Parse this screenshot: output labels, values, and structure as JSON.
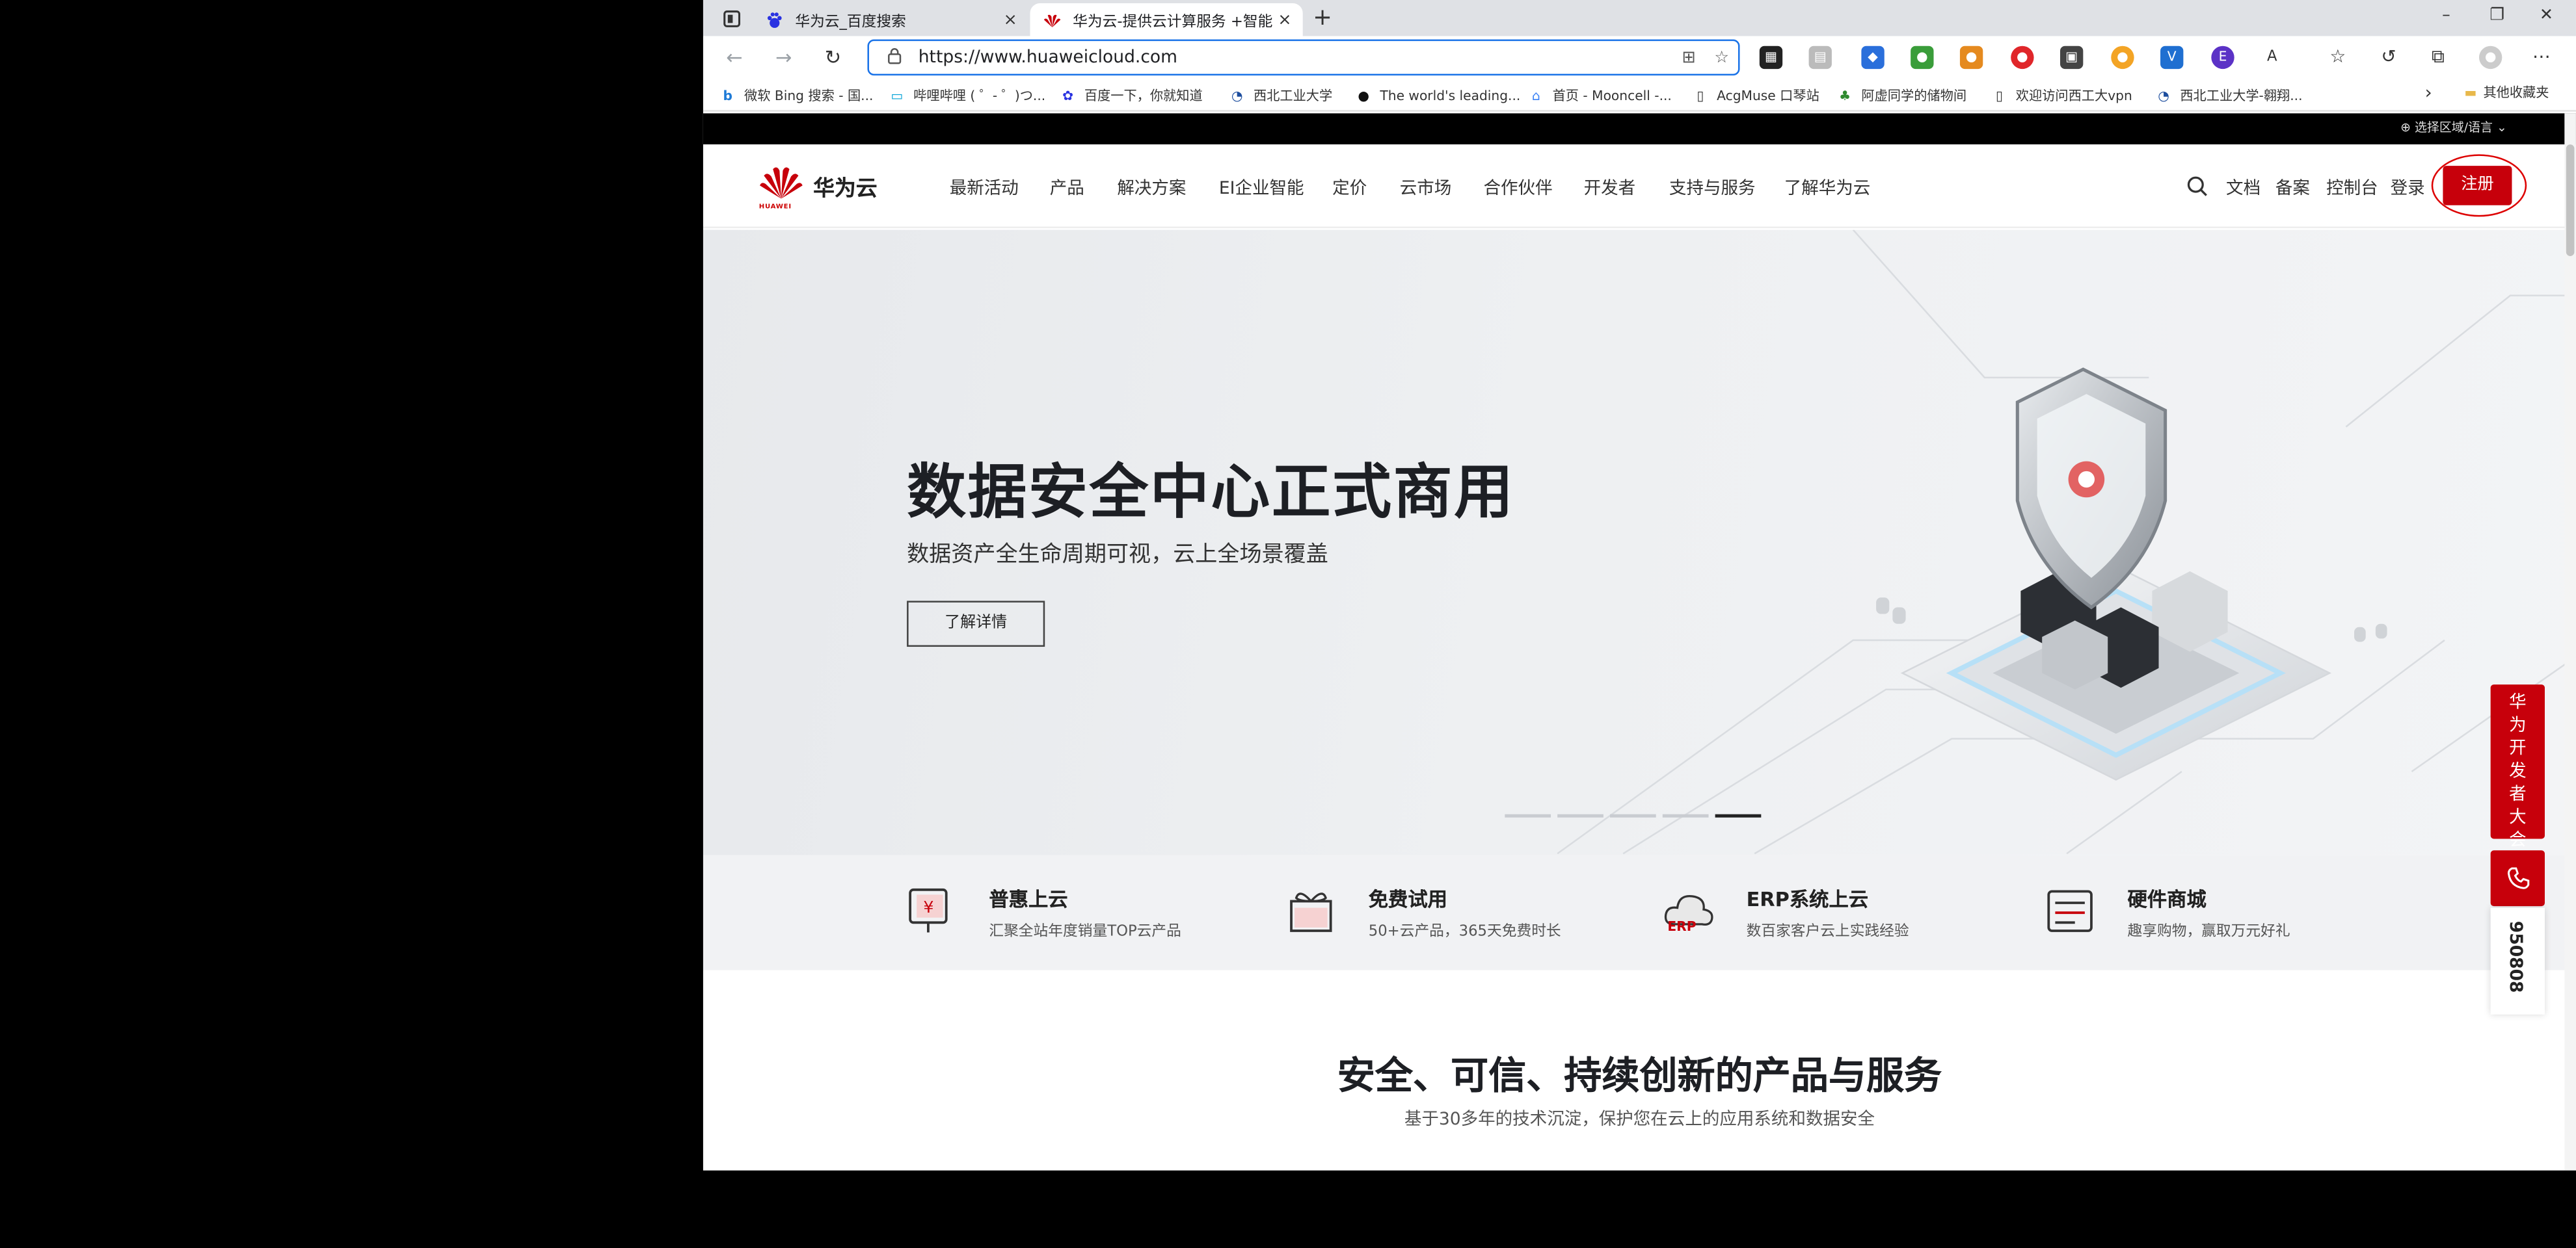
{
  "browser": {
    "tabs": [
      {
        "title": "华为云_百度搜索",
        "close": "×"
      },
      {
        "title": "华为云-提供云计算服务 +智能,",
        "close": "×"
      }
    ],
    "new_tab": "+",
    "window_controls": {
      "minimize": "–",
      "maximize": "❐",
      "close": "✕"
    },
    "address": "https://www.huaweicloud.com",
    "bookmarks": [
      "微软 Bing 搜索 - 国...",
      "哔哩哔哩 ( ゜- ゜)つ...",
      "百度一下，你就知道",
      "西北工业大学",
      "The world's leading...",
      "首页 - Mooncell -...",
      "AcgMuse 口琴站",
      "阿虚同学的储物间",
      "欢迎访问西工大vpn",
      "西北工业大学-翱翔..."
    ],
    "bookmarks_more": "›",
    "other_bookmarks": "其他收藏夹"
  },
  "page": {
    "region": "选择区域/语言",
    "logo_name": "华为云",
    "logo_sub": "HUAWEI",
    "menu": [
      "最新活动",
      "产品",
      "解决方案",
      "EI企业智能",
      "定价",
      "云市场",
      "合作伙伴",
      "开发者",
      "支持与服务",
      "了解华为云"
    ],
    "utility": [
      "文档",
      "备案",
      "控制台",
      "登录"
    ],
    "register": "注册",
    "hero": {
      "title": "数据安全中心正式商用",
      "subtitle": "数据资产全生命周期可视，云上全场景覆盖",
      "button": "了解详情",
      "slides": 5,
      "active_slide": 5
    },
    "features": [
      {
        "title": "普惠上云",
        "desc": "汇聚全站年度销量TOP云产品"
      },
      {
        "title": "免费试用",
        "desc": "50+云产品，365天免费时长"
      },
      {
        "title": "ERP系统上云",
        "desc": "数百家客户云上实践经验"
      },
      {
        "title": "硬件商城",
        "desc": "趣享购物，赢取万元好礼"
      }
    ],
    "section_title": "安全、可信、持续创新的产品与服务",
    "section_sub": "基于30多年的技术沉淀，保护您在云上的应用系统和数据安全",
    "side_banner": "华为开发者大会",
    "hotline": "950808"
  },
  "colors": {
    "brand_red": "#c7000b",
    "omnibox_border": "#1a73e8"
  }
}
